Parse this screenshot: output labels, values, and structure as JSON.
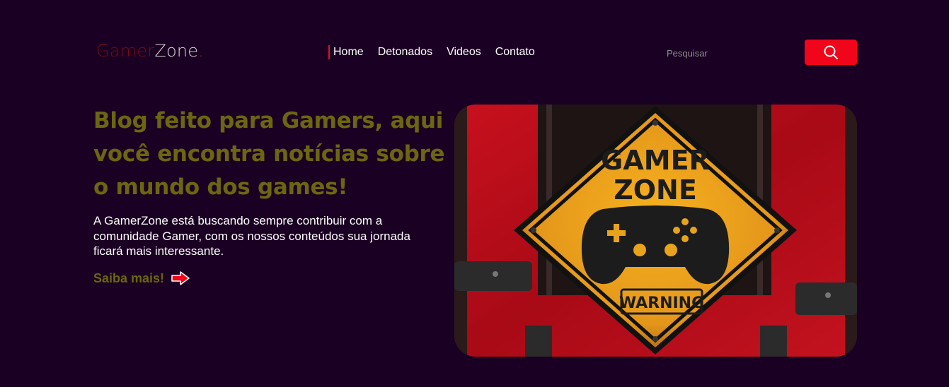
{
  "header": {
    "logo": {
      "part1": "Gamer",
      "part2": "Zone",
      "dot": "."
    },
    "nav": [
      {
        "label": "Home",
        "active": true
      },
      {
        "label": "Detonados",
        "active": false
      },
      {
        "label": "Videos",
        "active": false
      },
      {
        "label": "Contato",
        "active": false
      }
    ],
    "search": {
      "placeholder": "Pesquisar",
      "value": "",
      "button_icon": "search-icon"
    }
  },
  "hero": {
    "headline": "Blog feito para Gamers, aqui você encontra notícias sobre o mundo dos games!",
    "intro": "A GamerZone está buscando sempre contribuir com a comunidade Gamer, com os nossos conteúdos sua jornada ficará mais interessante.",
    "cta": {
      "label": "Saiba mais!",
      "icon": "arrow-right-icon"
    },
    "image": {
      "sign_line1": "GAMER",
      "sign_line2": "ZONE",
      "warning": "WARNING",
      "icon": "gamepad-icon"
    }
  },
  "colors": {
    "background": "#1a0022",
    "accent": "#f0051a",
    "headline": "#6b6610",
    "sign_yellow": "#f0a418"
  }
}
